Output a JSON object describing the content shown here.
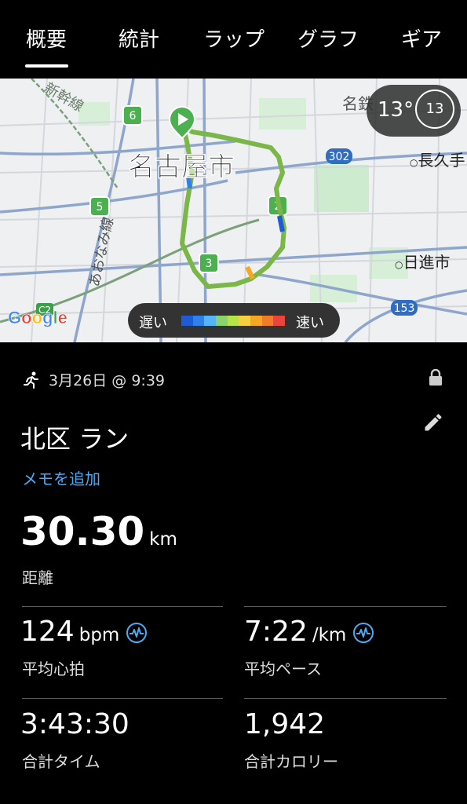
{
  "tabs": [
    {
      "label": "概要",
      "active": true
    },
    {
      "label": "統計"
    },
    {
      "label": "ラップ"
    },
    {
      "label": "グラフ"
    },
    {
      "label": "ギア"
    }
  ],
  "map": {
    "city_label": "名古屋市",
    "place_nagakute": "長久手",
    "place_nisshin": "日進市",
    "road_aonami": "あおなみ線",
    "road_label_top": "名鉄",
    "road_label_rail": "新幹線",
    "route_badges": [
      "6",
      "5",
      "2",
      "3"
    ],
    "road_302": "302",
    "road_153": "153",
    "road_c2": "C2",
    "google_logo": "Google",
    "logo_colors": [
      "#4285F4",
      "#EA4335",
      "#FBBC05",
      "#4285F4",
      "#34A853",
      "#EA4335"
    ],
    "route_color": "#8bc34a",
    "start_marker_color": "#4caf50"
  },
  "weather": {
    "temp": "13°",
    "ring_value": "13"
  },
  "speed_legend": {
    "slow": "遅い",
    "fast": "速い",
    "colors": [
      "#1e5bd6",
      "#2f80ed",
      "#56b4f9",
      "#8bd36b",
      "#b6e34a",
      "#f5d142",
      "#f5a623",
      "#f07c2a",
      "#e8453c"
    ]
  },
  "activity": {
    "date": "3月26日 @ 9:39",
    "title": "北区 ラン",
    "memo": "メモを追加"
  },
  "distance": {
    "value": "30.30",
    "unit": "km",
    "label": "距離"
  },
  "stats": {
    "hr_value": "124",
    "hr_unit": "bpm",
    "hr_label": "平均心拍",
    "pace_value": "7:22",
    "pace_unit": "/km",
    "pace_label": "平均ペース",
    "time_value": "3:43:30",
    "time_label": "合計タイム",
    "cal_value": "1,942",
    "cal_label": "合計カロリー"
  }
}
